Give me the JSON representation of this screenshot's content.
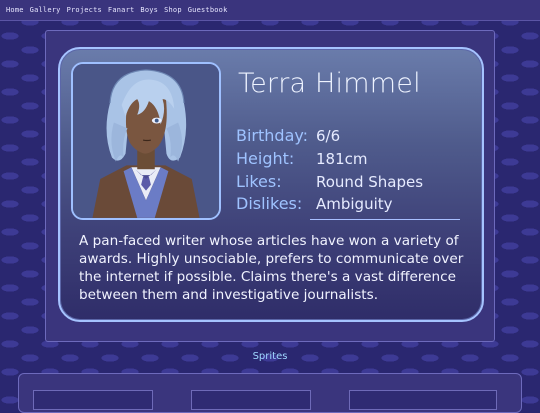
{
  "nav": {
    "items": [
      "Home",
      "Gallery",
      "Projects",
      "Fanart",
      "Boys",
      "Shop",
      "Guestbook"
    ]
  },
  "profile": {
    "name": "Terra Himmel",
    "stats": [
      {
        "label": "Birthday:",
        "value": "6/6"
      },
      {
        "label": "Height:",
        "value": "181cm"
      },
      {
        "label": "Likes:",
        "value": "Round Shapes"
      },
      {
        "label": "Dislikes:",
        "value": "Ambiguity"
      }
    ],
    "description": "A pan-faced writer whose articles have won a variety of awards. Highly unsociable, prefers to communicate over the internet if possible. Claims there's a vast difference between them and investigative journalists."
  },
  "sprites": {
    "title": "Sprites"
  },
  "colors": {
    "background": "#2a2770",
    "panel": "#3a357d",
    "accent": "#a5c3ff",
    "label": "#9fc3ff",
    "section_title": "#9fd7ff"
  }
}
